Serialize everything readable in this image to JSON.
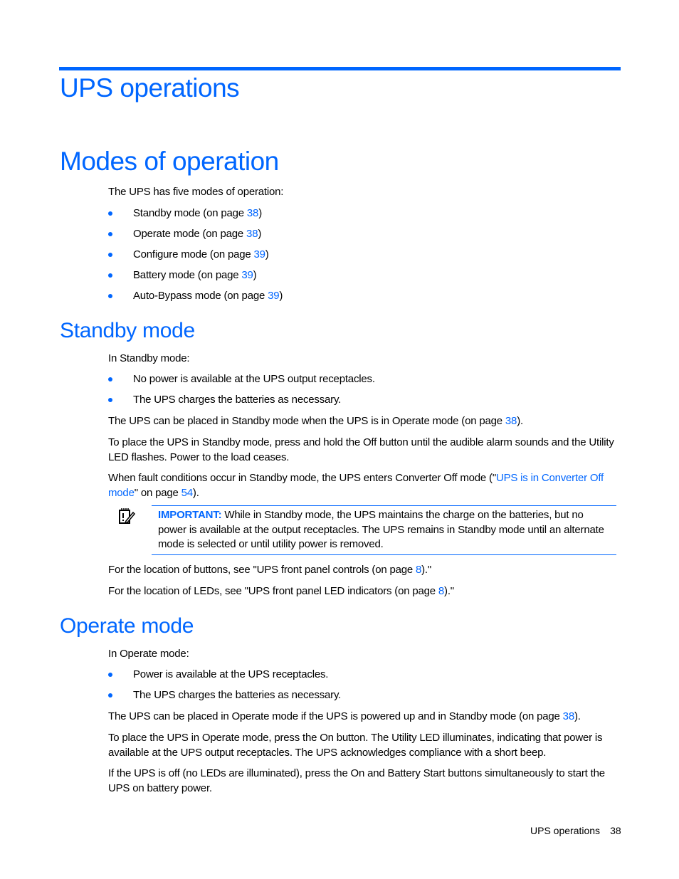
{
  "chapter": {
    "title": "UPS operations"
  },
  "section": {
    "title": "Modes of operation",
    "intro": "The UPS has five modes of operation:",
    "modes": [
      {
        "text": "Standby mode (on page ",
        "page": "38",
        "suffix": ")"
      },
      {
        "text": "Operate mode (on page ",
        "page": "38",
        "suffix": ")"
      },
      {
        "text": "Configure mode (on page ",
        "page": "39",
        "suffix": ")"
      },
      {
        "text": "Battery mode (on page ",
        "page": "39",
        "suffix": ")"
      },
      {
        "text": "Auto-Bypass mode (on page ",
        "page": "39",
        "suffix": ")"
      }
    ]
  },
  "standby": {
    "title": "Standby mode",
    "intro": "In Standby mode:",
    "bullets": [
      "No power is available at the UPS output receptacles.",
      "The UPS charges the batteries as necessary."
    ],
    "p1": {
      "text": "The UPS can be placed in Standby mode when the UPS is in Operate mode (on page ",
      "page": "38",
      "suffix": ")."
    },
    "p2": "To place the UPS in Standby mode, press and hold the Off button until the audible alarm sounds and the Utility LED flashes. Power to the load ceases.",
    "p3": {
      "text": "When fault conditions occur in Standby mode, the UPS enters Converter Off mode (\"",
      "link": "UPS is in Converter Off mode",
      "mid": "\" on page ",
      "page": "54",
      "suffix": ")."
    },
    "note": {
      "icon": "important-note-icon",
      "label": "IMPORTANT:",
      "text": " While in Standby mode, the UPS maintains the charge on the batteries, but no power is available at the output receptacles. The UPS remains in Standby mode until an alternate mode is selected or until utility power is removed."
    },
    "p4": {
      "text": "For the location of buttons, see \"UPS front panel controls (on page ",
      "page": "8",
      "suffix": ").\""
    },
    "p5": {
      "text": "For the location of LEDs, see \"UPS front panel LED indicators (on page ",
      "page": "8",
      "suffix": ").\""
    }
  },
  "operate": {
    "title": "Operate mode",
    "intro": "In Operate mode:",
    "bullets": [
      "Power is available at the UPS receptacles.",
      "The UPS charges the batteries as necessary."
    ],
    "p1": {
      "text": "The UPS can be placed in Operate mode if the UPS is powered up and in Standby mode (on page ",
      "page": "38",
      "suffix": ")."
    },
    "p2": "To place the UPS in Operate mode, press the On button. The Utility LED illuminates, indicating that power is available at the UPS output receptacles. The UPS acknowledges compliance with a short beep.",
    "p3": "If the UPS is off (no LEDs are illuminated), press the On and Battery Start buttons simultaneously to start the UPS on battery power."
  },
  "footer": {
    "section": "UPS operations",
    "page": "38"
  },
  "colors": {
    "accent": "#0066ff",
    "text": "#000000"
  }
}
